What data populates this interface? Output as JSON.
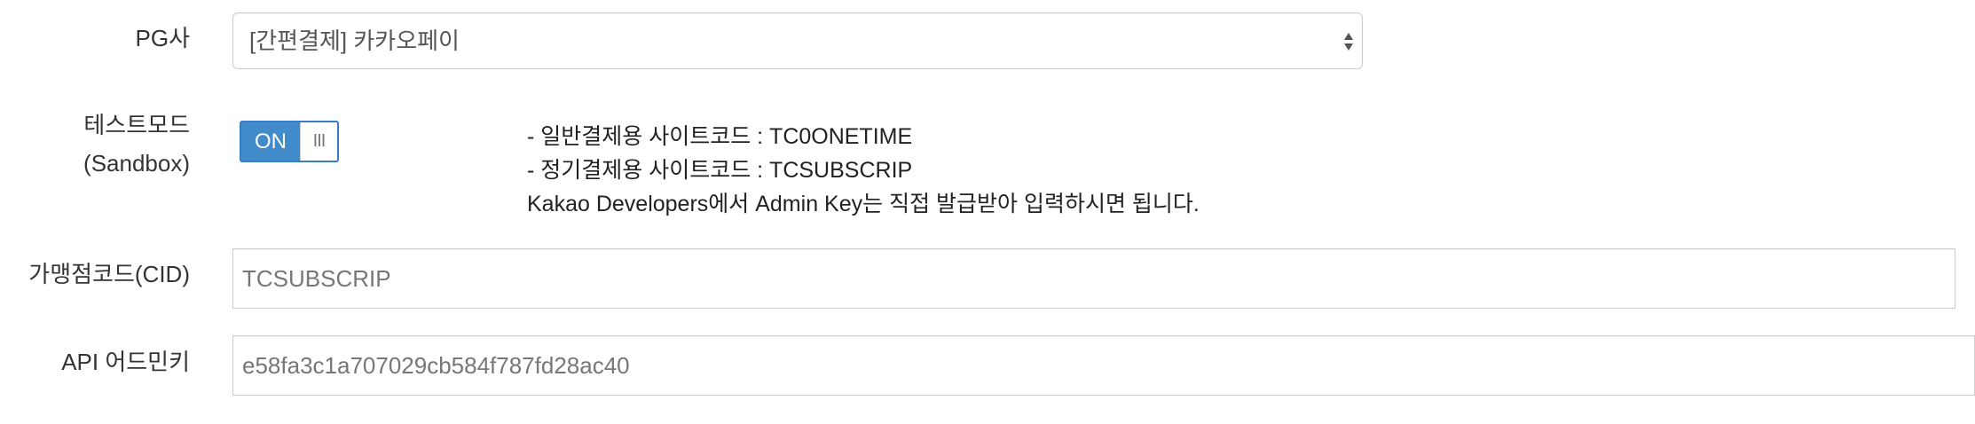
{
  "fields": {
    "pg": {
      "label": "PG사",
      "selected": "[간편결제] 카카오페이"
    },
    "test_mode": {
      "label_line1": "테스트모드",
      "label_line2": "(Sandbox)",
      "toggle_on_label": "ON",
      "toggle_handle_label": "III",
      "toggle_state": "on"
    },
    "help_text": [
      "- 일반결제용 사이트코드 : TC0ONETIME",
      "- 정기결제용 사이트코드 : TCSUBSCRIP",
      "Kakao Developers에서 Admin Key는 직접 발급받아 입력하시면 됩니다."
    ],
    "cid": {
      "label": "가맹점코드(CID)",
      "value": "TCSUBSCRIP"
    },
    "api_key": {
      "label": "API 어드민키",
      "value": "e58fa3c1a707029cb584f787fd28ac40"
    }
  },
  "colors": {
    "toggle_on": "#428bca",
    "border": "#cccccc",
    "label_text": "#333333",
    "input_text": "#777777"
  }
}
